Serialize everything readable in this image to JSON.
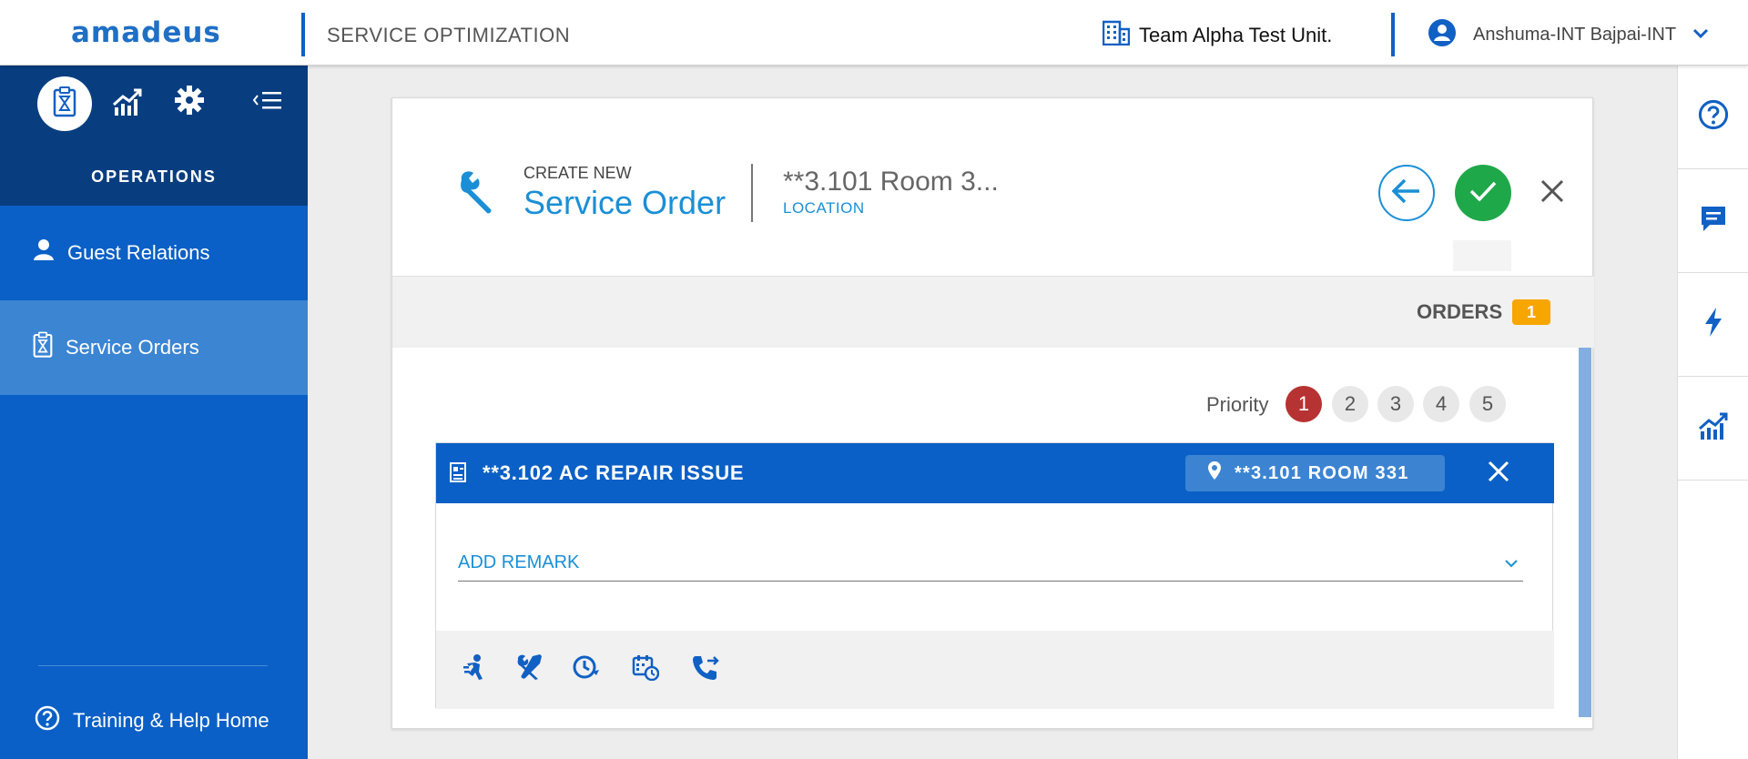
{
  "header": {
    "logo": "amadeus",
    "app_title": "SERVICE OPTIMIZATION",
    "unit_name": "Team Alpha Test Unit.",
    "user_name": "Anshuma-INT Bajpai-INT"
  },
  "sidebar": {
    "section_title": "OPERATIONS",
    "items": [
      {
        "label": "Guest Relations"
      },
      {
        "label": "Service Orders"
      }
    ],
    "help_label": "Training & Help Home"
  },
  "form": {
    "create_new": "CREATE NEW",
    "title": "Service Order",
    "location_value": "**3.101 Room 3...",
    "location_label": "LOCATION",
    "orders_label": "ORDERS",
    "orders_count": "1",
    "priority_label": "Priority",
    "priorities": [
      "1",
      "2",
      "3",
      "4",
      "5"
    ],
    "selected_priority": "1"
  },
  "order": {
    "title": "**3.102 AC REPAIR ISSUE",
    "location_chip": "**3.101 ROOM 331",
    "remark_label": "ADD REMARK"
  },
  "colors": {
    "brand_blue": "#0a60c6",
    "accent_blue": "#1a8fd6",
    "confirm_green": "#1fa84a",
    "priority_red": "#b73232",
    "badge_orange": "#f7a600"
  }
}
